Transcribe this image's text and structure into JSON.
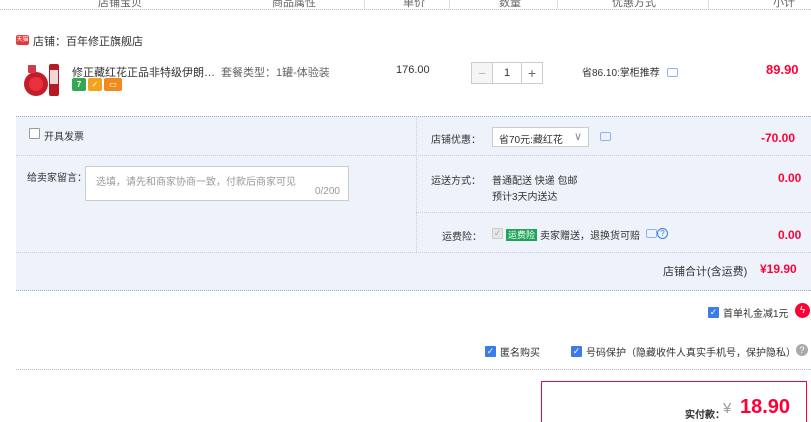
{
  "header": {
    "columns": [
      "店铺宝贝",
      "商品属性",
      "单价",
      "数量",
      "优惠方式",
      "小计"
    ]
  },
  "shop": {
    "badge": "天猫",
    "name": "店铺：百年修正旗舰店"
  },
  "item": {
    "title": "修正藏红花正品非特级伊朗西红...",
    "attr": "套餐类型：1罐-体验装",
    "price": "176.00",
    "quantity": "1",
    "minus": "−",
    "plus": "+",
    "promo": "省86.10:掌柜推荐",
    "subtotal": "89.90",
    "icons": [
      "7",
      "✓",
      "▭"
    ]
  },
  "options": {
    "invoice_label": "开具发票",
    "memo_label": "给卖家留言：",
    "memo_placeholder": "选填，请先和商家协商一致，付款后商家可见",
    "memo_count": "0/200",
    "shop_discount_label": "店铺优惠：",
    "shop_discount_value": "省70元:藏红花",
    "shop_discount_amount": "-70.00",
    "shipping_label": "运送方式：",
    "shipping_value": "普通配送 快递 包邮",
    "shipping_eta": "预计3天内送达",
    "shipping_amount": "0.00",
    "insurance_label": "运费险：",
    "insurance_badge": "运费险",
    "insurance_value": "卖家赠送，退换货可赔",
    "insurance_amount": "0.00"
  },
  "totals": {
    "shop_total_label": "店铺合计(含运费)",
    "shop_total_value": "¥19.90",
    "gift_label": "首单礼金减1元",
    "anon_label": "匿名购买",
    "phone_label": "号码保护（隐藏收件人真实手机号，保护隐私）",
    "pay_label": "实付款：",
    "pay_currency": "¥",
    "pay_value": "18.90"
  },
  "colors": {
    "accent": "#ff0036",
    "checkbox": "#3b7bea",
    "panel": "#eef3fb"
  }
}
